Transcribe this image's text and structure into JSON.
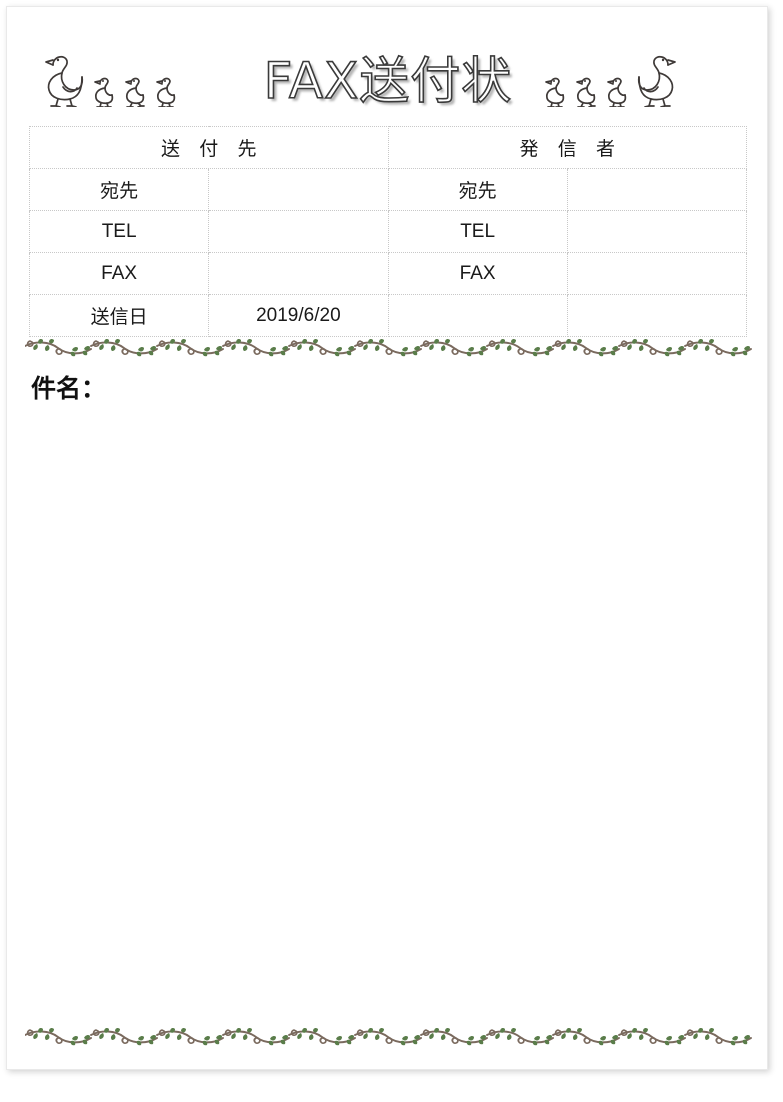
{
  "document": {
    "title": "FAX送付状",
    "subject_label": "件名："
  },
  "decorations": {
    "left_birds": [
      "goose-icon",
      "chick-icon",
      "chick-icon",
      "chick-icon"
    ],
    "right_birds": [
      "chick-icon",
      "chick-icon",
      "chick-icon",
      "goose-icon"
    ],
    "vine_border_top": "vine-border-icon",
    "vine_border_bottom": "vine-border-icon",
    "vine_stem_color": "#7a6a5e",
    "vine_leaf_color": "#5a7d4a",
    "bird_outline_color": "#3f3a38"
  },
  "table": {
    "headers": {
      "recipient": "送 付 先",
      "sender": "発 信 者"
    },
    "rows": [
      {
        "left_label": "宛先",
        "left_value": "",
        "right_label": "宛先",
        "right_value": ""
      },
      {
        "left_label": "TEL",
        "left_value": "",
        "right_label": "TEL",
        "right_value": ""
      },
      {
        "left_label": "FAX",
        "left_value": "",
        "right_label": "FAX",
        "right_value": ""
      },
      {
        "left_label": "送信日",
        "left_value": "2019/6/20",
        "right_label": "",
        "right_value": ""
      }
    ]
  }
}
